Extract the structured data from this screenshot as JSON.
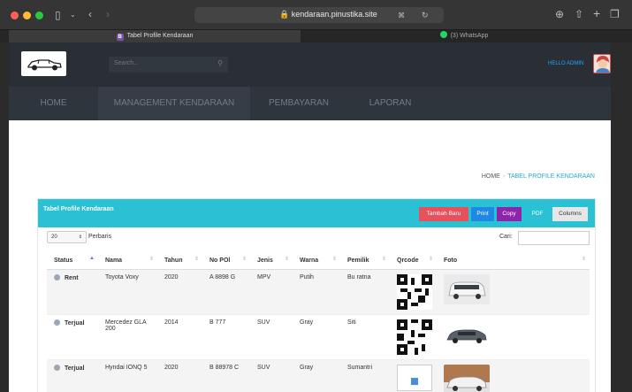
{
  "browser": {
    "url": "kendaraan.pinustika.site",
    "tabs": [
      {
        "label": "Tabel Profile Kendaraan",
        "icon": "B"
      },
      {
        "label": "(3) WhatsApp"
      }
    ]
  },
  "header": {
    "search_placeholder": "Search...",
    "user_label": "HELLO ADMIN"
  },
  "nav": {
    "items": [
      "HOME",
      "MANAGEMENT KENDARAAN",
      "PEMBAYARAN",
      "LAPORAN"
    ]
  },
  "breadcrumb": {
    "home": "HOME",
    "current": "TABEL PROFILE KENDARAAN"
  },
  "panel": {
    "title": "Tabel Profile Kendaraan",
    "buttons": {
      "add": "Tambah Baru",
      "print": "Print",
      "copy": "Copy",
      "pdf": "PDF",
      "columns": "Columns"
    },
    "length_value": "20",
    "length_label": "Perbaris",
    "search_label": "Cari:"
  },
  "table": {
    "headers": [
      "Status",
      "Nama",
      "Tahun",
      "No POl",
      "Jenis",
      "Warna",
      "Pemilik",
      "Qrcode",
      "Foto"
    ],
    "rows": [
      {
        "status": "Rent",
        "nama": "Toyota Voxy",
        "tahun": "2020",
        "nopol": "A 8898 G",
        "jenis": "MPV",
        "warna": "Putih",
        "pemilik": "Bu ratna"
      },
      {
        "status": "Terjual",
        "nama": "Mercedez GLA 200",
        "tahun": "2014",
        "nopol": "B 777",
        "jenis": "SUV",
        "warna": "Gray",
        "pemilik": "Siti"
      },
      {
        "status": "Terjual",
        "nama": "Hyndai IONQ 5",
        "tahun": "2020",
        "nopol": "B 88978 C",
        "jenis": "SUV",
        "warna": "Gray",
        "pemilik": "Sumantri"
      }
    ]
  },
  "colors": {
    "accent": "#29c1d3",
    "btn_add": "#e8505b",
    "btn_print": "#1e88e5",
    "btn_copy": "#8e24aa",
    "btn_pdf": "#29c1d3",
    "btn_columns": "#e6e6e6"
  }
}
